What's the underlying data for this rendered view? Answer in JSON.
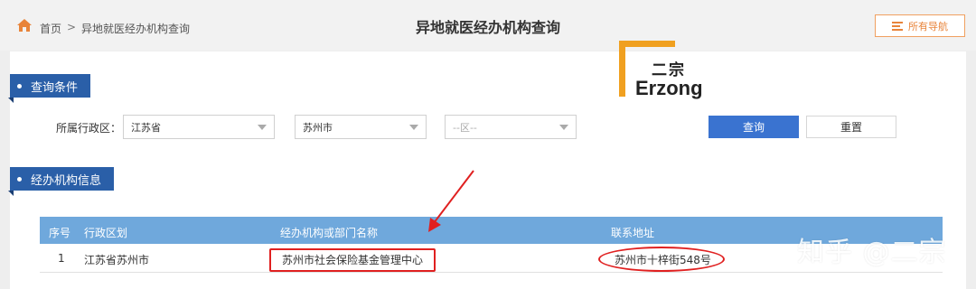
{
  "breadcrumb": {
    "home": "首页",
    "separator": ">",
    "current": "异地就医经办机构查询"
  },
  "page_title": "异地就医经办机构查询",
  "nav_button": {
    "label": "所有导航",
    "icon": "menu-list-icon"
  },
  "sections": {
    "query": "查询条件",
    "info": "经办机构信息"
  },
  "filters": {
    "region_label": "所属行政区：",
    "province": "江苏省",
    "city": "苏州市",
    "district_placeholder": "--区--"
  },
  "buttons": {
    "query": "查询",
    "reset": "重置"
  },
  "logo": {
    "cn": "二宗",
    "en": "Erzong"
  },
  "table": {
    "headers": [
      "序号",
      "行政区划",
      "经办机构或部门名称",
      "联系地址"
    ],
    "rows": [
      [
        "1",
        "江苏省苏州市",
        "苏州市社会保险基金管理中心",
        "苏州市十梓街548号"
      ]
    ]
  },
  "watermark": "知乎 @二宗",
  "colors": {
    "accent": "#2a5fa8",
    "query_button": "#3a73d0",
    "table_header": "#6fa8dc",
    "nav_border": "#f0a060",
    "highlight": "#e02020",
    "logo": "#f0a020"
  }
}
